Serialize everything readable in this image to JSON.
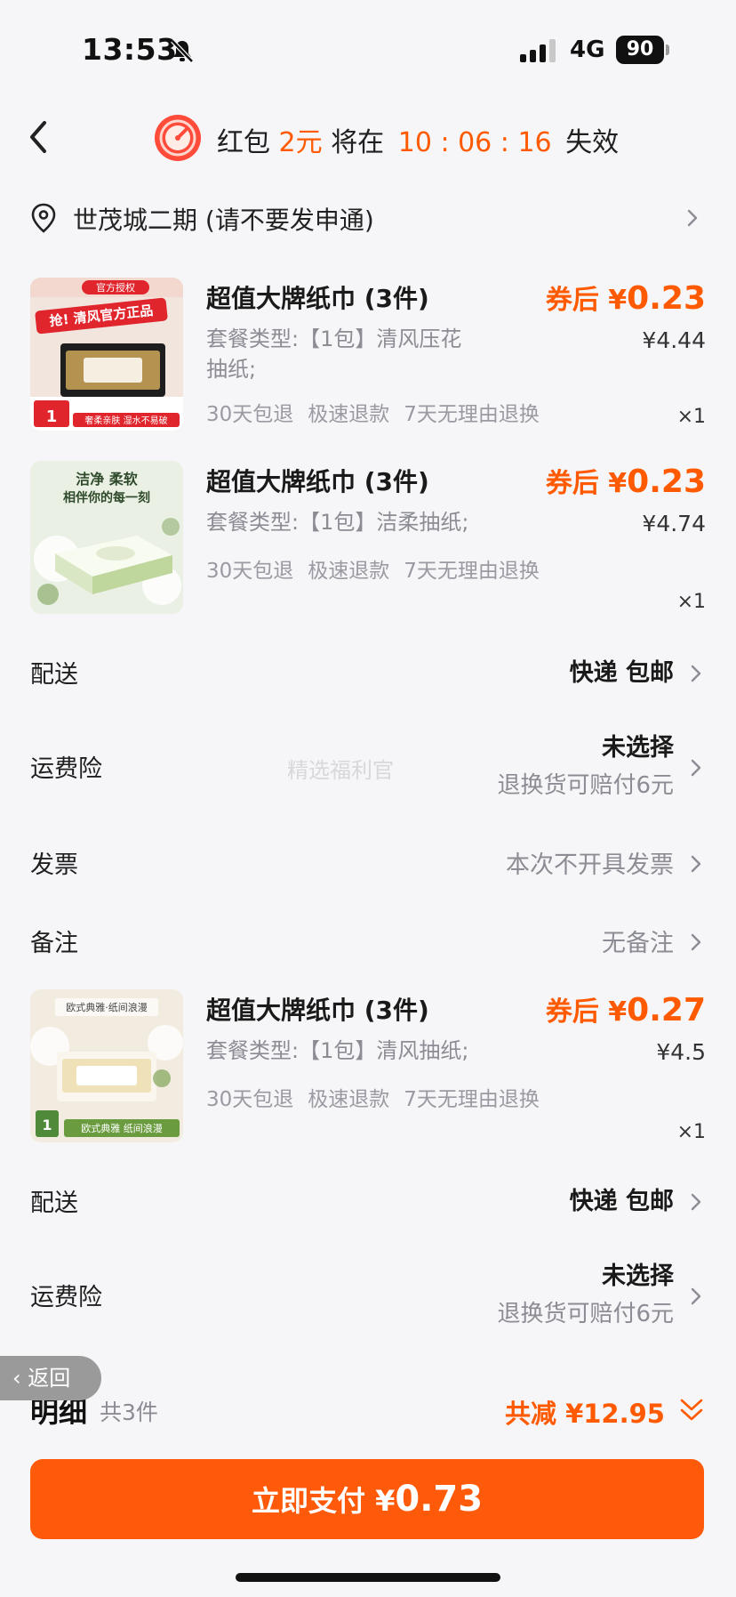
{
  "status_bar": {
    "time": "13:53",
    "network": "4G",
    "battery": "90"
  },
  "header": {
    "prefix": "红包",
    "amount": "2元",
    "middle": "将在",
    "countdown": "10 : 06 : 16",
    "suffix": "失效"
  },
  "address": {
    "text": "世茂城二期 (请不要发申通)"
  },
  "products": [
    {
      "title": "超值大牌纸巾 (3件)",
      "price_prefix": "券后 ¥",
      "price": "0.23",
      "spec": "套餐类型:【1包】清风压花抽纸;",
      "original_price": "¥4.44",
      "tags": [
        "30天包退",
        "极速退款",
        "7天无理由退换"
      ],
      "qty": "×1",
      "thumb_text": [
        "官方授权",
        "抢! 清风官方正品",
        "奢柔亲肤 湿水不易破",
        "1"
      ]
    },
    {
      "title": "超值大牌纸巾 (3件)",
      "price_prefix": "券后 ¥",
      "price": "0.23",
      "spec": "套餐类型:【1包】洁柔抽纸;",
      "original_price": "¥4.74",
      "tags": [
        "30天包退",
        "极速退款",
        "7天无理由退换"
      ],
      "qty": "×1",
      "thumb_text": [
        "洁净 柔软",
        "相伴你的每一刻"
      ]
    },
    {
      "title": "超值大牌纸巾 (3件)",
      "price_prefix": "券后 ¥",
      "price": "0.27",
      "spec": "套餐类型:【1包】清风抽纸;",
      "original_price": "¥4.5",
      "tags": [
        "30天包退",
        "极速退款",
        "7天无理由退换"
      ],
      "qty": "×1",
      "thumb_text": [
        "欧式典雅·纸间浪漫",
        "欧式典雅 纸间浪漫",
        "1"
      ]
    }
  ],
  "rows": {
    "delivery_1": {
      "label": "配送",
      "value": "快递 包邮"
    },
    "insurance_1": {
      "label": "运费险",
      "value": "未选择",
      "sub": "退换货可赔付6元"
    },
    "invoice": {
      "label": "发票",
      "value": "本次不开具发票"
    },
    "remark": {
      "label": "备注",
      "value": "无备注"
    },
    "delivery_2": {
      "label": "配送",
      "value": "快递 包邮"
    },
    "insurance_2": {
      "label": "运费险",
      "value": "未选择",
      "sub": "退换货可赔付6元"
    }
  },
  "watermark": "精选福利官",
  "float_back": {
    "label": "返回"
  },
  "summary": {
    "label": "明细",
    "count": "共3件",
    "discount": "共减 ¥12.95"
  },
  "pay": {
    "label": "立即支付",
    "currency": "¥",
    "amount": "0.73"
  },
  "colors": {
    "accent": "#ff5a00",
    "button": "#ff5a0a",
    "grey_text": "#8c8c94"
  }
}
